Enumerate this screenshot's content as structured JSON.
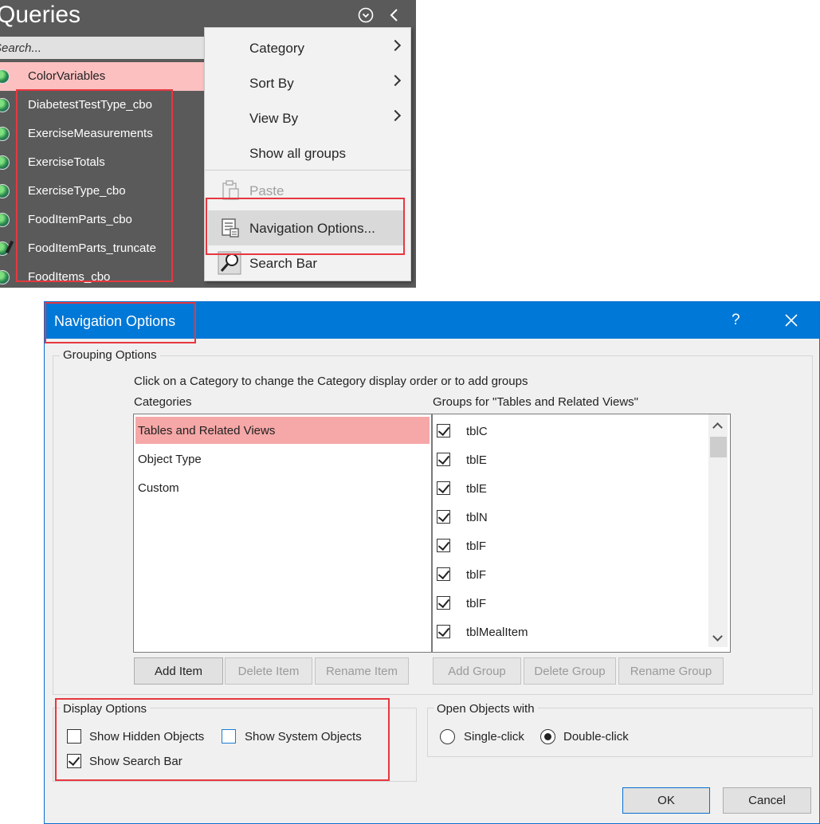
{
  "nav": {
    "title": "Queries",
    "search_placeholder": "Search...",
    "items": [
      {
        "label": "ColorVariables",
        "selected": true
      },
      {
        "label": "DiabetestTestType_cbo"
      },
      {
        "label": "ExerciseMeasurements"
      },
      {
        "label": "ExerciseTotals"
      },
      {
        "label": "ExerciseType_cbo"
      },
      {
        "label": "FoodItemParts_cbo"
      },
      {
        "label": "FoodItemParts_truncate"
      },
      {
        "label": "FoodItems_cbo"
      }
    ]
  },
  "context_menu": {
    "items": [
      {
        "label": "Category",
        "submenu": true
      },
      {
        "label": "Sort By",
        "submenu": true
      },
      {
        "label": "View By",
        "submenu": true
      },
      {
        "label": "Show all groups"
      },
      {
        "label": "Paste",
        "disabled": true
      },
      {
        "label": "Navigation Options...",
        "hover": true
      },
      {
        "label": "Search Bar"
      }
    ]
  },
  "dialog": {
    "title": "Navigation Options",
    "help": "?",
    "grouping": {
      "legend": "Grouping Options",
      "instruction": "Click on a Category to change the Category display order or to add groups",
      "categories_label": "Categories",
      "groups_label": "Groups for \"Tables and Related Views\"",
      "categories": [
        "Tables and Related Views",
        "Object Type",
        "Custom"
      ],
      "groups": [
        "tblC",
        "tblE",
        "tblE",
        "tblN",
        "tblF",
        "tblF",
        "tblF",
        "tblMealItem"
      ]
    },
    "buttons": {
      "add_item": "Add Item",
      "delete_item": "Delete Item",
      "rename_item": "Rename Item",
      "add_group": "Add Group",
      "delete_group": "Delete Group",
      "rename_group": "Rename Group",
      "ok": "OK",
      "cancel": "Cancel"
    },
    "display": {
      "legend": "Display Options",
      "show_hidden": "Show Hidden Objects",
      "show_system": "Show System Objects",
      "show_search": "Show Search Bar"
    },
    "open": {
      "legend": "Open Objects with",
      "single": "Single-click",
      "double": "Double-click"
    }
  },
  "colors": {
    "nav_bg": "#5a5a5a",
    "selected_row": "#fcc0c0",
    "title_bar": "#0078d7",
    "highlight_box": "#e8373e"
  }
}
